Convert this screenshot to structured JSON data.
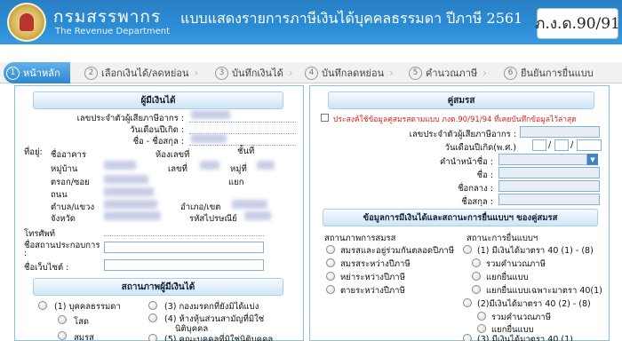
{
  "header": {
    "dept_th": "กรมสรรพากร",
    "dept_en": "The Revenue Department",
    "form_title": "แบบแสดงรายการภาษีเงินได้บุคคลธรรมดา ปีภาษี 2561",
    "form_code": "ภ.ง.ด.90/91"
  },
  "steps": [
    {
      "num": "1",
      "label": "หน้าหลัก"
    },
    {
      "num": "2",
      "label": "เลือกเงินได้/ลดหย่อน"
    },
    {
      "num": "3",
      "label": "บันทึกเงินได้"
    },
    {
      "num": "4",
      "label": "บันทึกลดหย่อน"
    },
    {
      "num": "5",
      "label": "คำนวณภาษี"
    },
    {
      "num": "6",
      "label": "ยืนยันการยื่นแบบ"
    }
  ],
  "left": {
    "section_title": "ผู้มีเงินได้",
    "tax_id_label": "เลขประจำตัวผู้เสียภาษีอากร :",
    "birth_label": "วันเดือนปีเกิด :",
    "name_label": "ชื่อ - ชื่อสกุล :",
    "address_label": "ที่อยู่:",
    "building_label": "ชื่ออาคาร",
    "room_label": "ห้องเลขที่",
    "floor_label": "ชั้นที่",
    "village_label": "หมู่บ้าน",
    "house_no_label": "เลขที่",
    "moo_label": "หมู่ที่",
    "soi_label": "ตรอก/ซอย",
    "junction_label": "แยก",
    "road_label": "ถนน",
    "subdistrict_label": "ตำบล/แขวง",
    "district_label": "อำเภอ/เขต",
    "province_label": "จังหวัด",
    "postcode_label": "รหัสไปรษณีย์",
    "phone_label": "โทรศัพท์",
    "business_label": "ชื่อสถานประกอบการ",
    "business_colon": ":",
    "website_label": "ชื่อเว็บไซต์ :",
    "status_section_title": "สถานภาพผู้มีเงินได้",
    "status_options": [
      "(1) บุคคลธรรมดา",
      "(3) กองมรดกที่ยังมิได้แบ่ง",
      "(4) ห้างหุ้นส่วนสามัญที่มิใช่",
      "นิติบุคคล",
      "(5) คณะบุคคลที่มิใช่นิติบุคคล"
    ],
    "sub_options": [
      "โสด",
      "สมรส"
    ]
  },
  "right": {
    "section_title": "คู่สมรส",
    "consent_text": "ประสงค์ใช้ข้อมูลคู่สมรสตามแบบ ภงด.90/91/94 ที่เคยบันทึกข้อมูลไว้ล่าสุด",
    "tax_id_label": "เลขประจำตัวผู้เสียภาษีอากร :",
    "birth_label": "วันเดือนปีเกิด(พ.ศ.)",
    "title_label": "คำนำหน้าชื่อ :",
    "first_label": "ชื่อ :",
    "middle_label": "ชื่อกลาง :",
    "last_label": "ชื่อสกุล :",
    "income_section_title": "ข้อมูลการมีเงินได้และสถานะการยื่นแบบฯ ของคู่สมรส",
    "marital_status_title": "สถานภาพการสมรส",
    "marital_options": [
      "สมรสและอยู่ร่วมกันตลอดปีภาษี",
      "สมรสระหว่างปีภาษี",
      "หย่าระหว่างปีภาษี",
      "ตายระหว่างปีภาษี"
    ],
    "filing_status_title": "สถานะการยื่นแบบฯ",
    "filing_options": [
      "(1) มีเงินได้มาตรา 40 (1) - (8)",
      "รวมคำนวณภาษี",
      "แยกยื่นแบบ",
      "แยกยื่นแบบเฉพาะมาตรา 40(1)",
      "(2)มีเงินได้มาตรา 40 (2) - (8)",
      "รวมคำนวณภาษี",
      "แยกยื่นแบบ",
      "(3) มีเงินได้มาตรา 40 (1)"
    ]
  }
}
